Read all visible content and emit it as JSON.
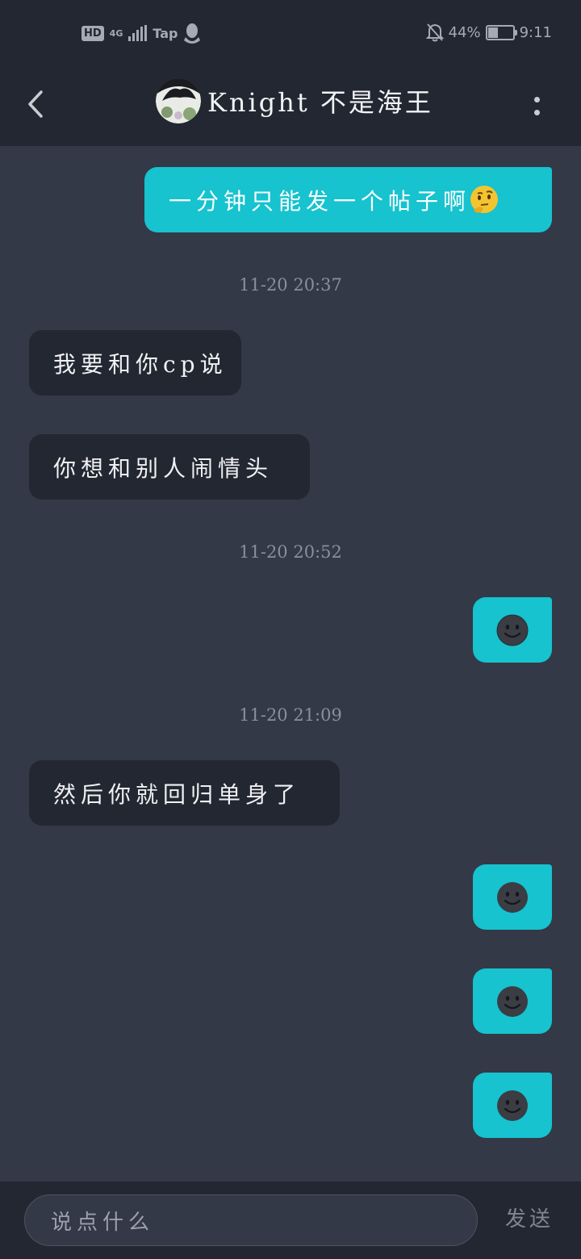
{
  "status_bar": {
    "hd_badge": "HD",
    "network": "4G",
    "app_label": "Tap",
    "battery_percent": "44%",
    "battery_level": 0.44,
    "time": "9:11"
  },
  "header": {
    "title": "Knight 不是海王",
    "back_icon": "chevron-left-icon",
    "more_icon": "more-vertical-icon"
  },
  "messages": [
    {
      "side": "outgoing",
      "text": "一分钟只能发一个帖子啊",
      "emoji": "thinking-face"
    },
    {
      "type": "timestamp",
      "text": "11-20 20:37"
    },
    {
      "side": "incoming",
      "text": "我要和你cp说"
    },
    {
      "side": "incoming",
      "text": "你想和别人闹情头"
    },
    {
      "type": "timestamp",
      "text": "11-20 20:52"
    },
    {
      "side": "outgoing",
      "emoji": "dark-smiley-face"
    },
    {
      "type": "timestamp",
      "text": "11-20 21:09"
    },
    {
      "side": "incoming",
      "text": "然后你就回归单身了"
    },
    {
      "side": "outgoing",
      "emoji": "dark-smiley-face"
    },
    {
      "side": "outgoing",
      "emoji": "dark-smiley-face"
    },
    {
      "side": "outgoing",
      "emoji": "dark-smiley-face"
    }
  ],
  "input": {
    "placeholder": "说点什么",
    "send_label": "发送"
  },
  "colors": {
    "background": "#333947",
    "bar": "#232731",
    "outgoing_bubble": "#16c3cf",
    "incoming_bubble": "#232731",
    "timestamp": "#8a8f9b"
  }
}
